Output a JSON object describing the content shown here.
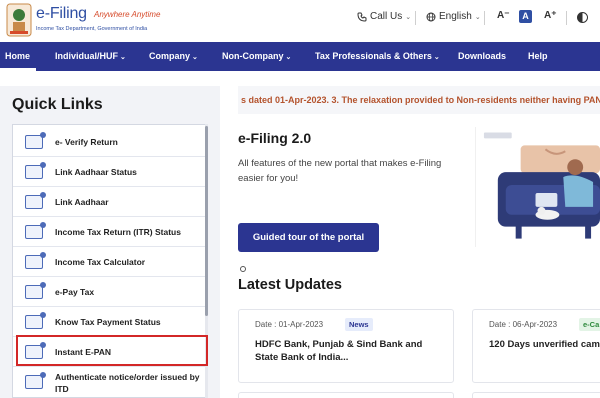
{
  "header": {
    "brand": "e-Filing",
    "tagline": "Anywhere Anytime",
    "department": "Income Tax Department, Government of India",
    "call_us": "Call Us",
    "language": "English",
    "font_decrease": "A⁻",
    "font_normal": "A",
    "font_increase": "A⁺"
  },
  "nav": {
    "items": [
      {
        "label": "Home",
        "chevron": ""
      },
      {
        "label": "Individual/HUF",
        "chevron": "⌄"
      },
      {
        "label": "Company",
        "chevron": "⌄"
      },
      {
        "label": "Non-Company",
        "chevron": "⌄"
      },
      {
        "label": "Tax Professionals & Others",
        "chevron": "⌄"
      },
      {
        "label": "Downloads",
        "chevron": ""
      },
      {
        "label": "Help",
        "chevron": ""
      }
    ]
  },
  "quick_links": {
    "title": "Quick Links",
    "items": [
      {
        "label": "e- Verify Return",
        "icon": "verify-return-icon"
      },
      {
        "label": "Link Aadhaar Status",
        "icon": "aadhaar-status-icon"
      },
      {
        "label": "Link Aadhaar",
        "icon": "link-aadhaar-icon"
      },
      {
        "label": "Income Tax Return (ITR) Status",
        "icon": "itr-status-icon"
      },
      {
        "label": "Income Tax Calculator",
        "icon": "calculator-icon"
      },
      {
        "label": "e-Pay Tax",
        "icon": "epay-tax-icon"
      },
      {
        "label": "Know Tax Payment Status",
        "icon": "payment-status-icon"
      },
      {
        "label": "Instant E-PAN",
        "icon": "instant-epan-icon"
      },
      {
        "label": "Authenticate notice/order issued by ITD",
        "icon": "authenticate-notice-icon"
      }
    ]
  },
  "ticker": {
    "text": "s dated 01-Apr-2023. 3. The relaxation provided to Non-residents neither having PAN n"
  },
  "hero": {
    "title": "e-Filing 2.0",
    "description": "All  features of the new portal that makes e-Filing easier for you!",
    "button": "Guided tour of the portal"
  },
  "updates": {
    "title": "Latest Updates",
    "cards": [
      {
        "date": "Date : 01-Apr-2023",
        "tag": "News",
        "headline": "HDFC Bank, Punjab & Sind Bank and State Bank of India..."
      },
      {
        "date": "Date : 06-Apr-2023",
        "tag": "e-Ca",
        "headline": "120 Days unverified cam"
      }
    ]
  },
  "colors": {
    "nav_bg": "#2b3591",
    "accent_red": "#d32727",
    "ticker_text": "#b4532d",
    "news_tag_bg": "#e6ecfb",
    "ecamp_tag_bg": "#e3f4e6"
  }
}
